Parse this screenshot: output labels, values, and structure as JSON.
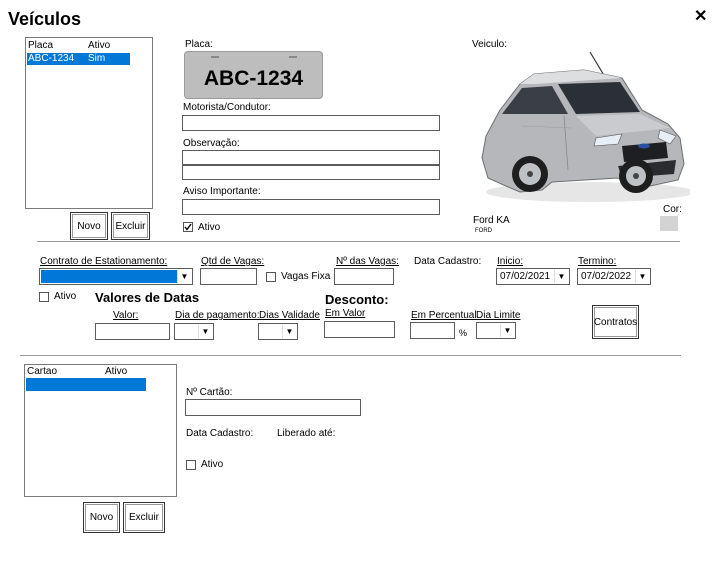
{
  "window": {
    "title": "Veículos",
    "close_glyph": "✕"
  },
  "vehicles": {
    "columns": [
      "Placa",
      "Ativo"
    ],
    "rows": [
      {
        "placa": "ABC-1234",
        "ativo": "Sim"
      }
    ],
    "new_label": "Novo",
    "delete_label": "Excluir"
  },
  "form": {
    "placa_label": "Placa:",
    "plate_text": "ABC-1234",
    "motorista_label": "Motorista/Condutor:",
    "observacao_label": "Observação:",
    "aviso_label": "Aviso Importante:",
    "ativo_label": "Ativo",
    "ativo_checked": true
  },
  "vehicle_panel": {
    "veiculo_label": "Veiculo:",
    "model": "Ford KA",
    "brand": "FORD",
    "cor_label": "Cor:",
    "color": "#d3d3d3"
  },
  "contract": {
    "contrato_label": "Contrato de Estationamento:",
    "contrato_value": "",
    "qtd_vagas_label": "Qtd de Vagas:",
    "vagas_fixa_label": "Vagas Fixa",
    "num_vagas_label": "Nº das Vagas:",
    "data_cadastro_label": "Data Cadastro:",
    "inicio_label": "Inicio:",
    "inicio_value": "07/02/2021",
    "termino_label": "Termino:",
    "termino_value": "07/02/2022",
    "ativo_label": "Ativo",
    "valores_title": "Valores de Datas",
    "valor_label": "Valor:",
    "dia_pagamento_label": "Dia de pagamento:",
    "dias_validade_label": "Dias Validade",
    "desconto_title": "Desconto:",
    "em_valor_label": "Em Valor",
    "em_percentual_label": "Em Percentual",
    "percent_sign": "%",
    "dia_limite_label": "Dia Limite",
    "contratos_button": "Contratos"
  },
  "cards": {
    "columns": [
      "Cartao",
      "Ativo"
    ],
    "numero_label": "Nº Cartão:",
    "data_cadastro_label": "Data Cadastro:",
    "liberado_label": "Liberado até:",
    "ativo_label": "Ativo",
    "new_label": "Novo",
    "delete_label": "Excluir"
  }
}
